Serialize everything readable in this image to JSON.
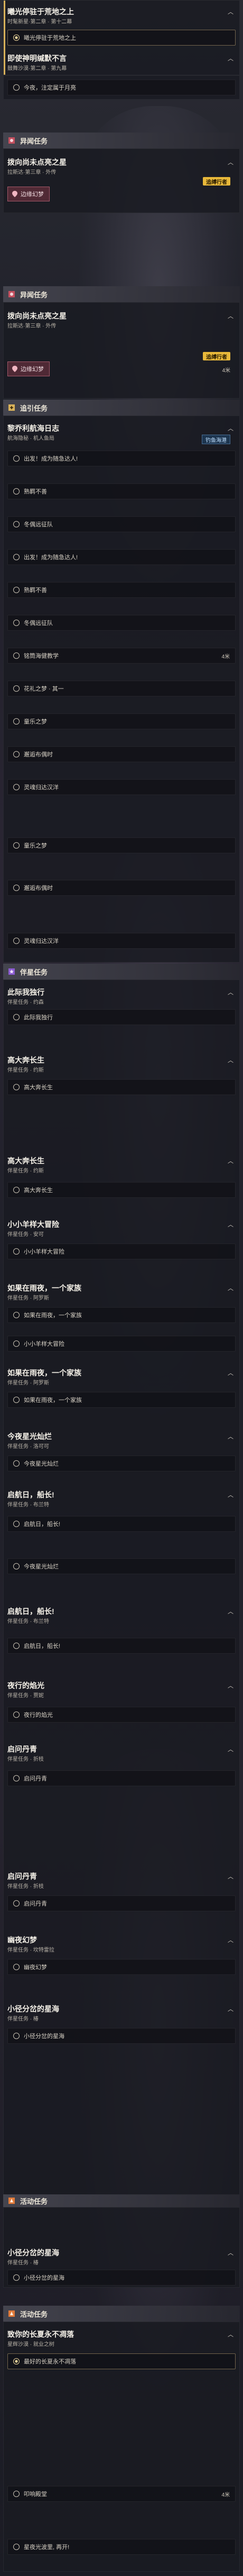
{
  "top": {
    "title1": "曦光停驻于荒地之上",
    "sub1": "时髦新星·第二章 · 第十二幕",
    "step1": "曦光停驻于荒地之上",
    "title2": "即使神明缄默不言",
    "sub2": "鼓舞沙漠·第二章 · 第九幕",
    "step2": "今夜，注定属于月亮"
  },
  "section_weiyi": {
    "label": "异闻任务"
  },
  "weiyi1": {
    "title": "拨向尚未点亮之星",
    "sub": "拉斯达·第三章 · 外传",
    "chip": "边缘幻梦",
    "badge": "追缚行者"
  },
  "section_weiyi2": {
    "label": "异闻任务"
  },
  "weiyi2": {
    "title": "拨向尚未点亮之星",
    "sub": "拉斯达·第三章 · 外传",
    "chip": "边缘幻梦",
    "badge": "追缚行者",
    "dist": "4米"
  },
  "section_zhui": {
    "label": "追引任务"
  },
  "zhui": {
    "title": "黎乔利航海日志",
    "sub": "航海隐秘 · 机人鱼局",
    "tag": "钓鱼海港",
    "steps": [
      "出发！成为随急达人!",
      "熟羁不善",
      "冬偶远征队",
      "出发！成为随急达人!",
      "熟羁不善",
      "冬偶远征队",
      "铭筒海健教学",
      "花礼之梦 · 其一",
      "童乐之梦",
      "邂逅布偶时",
      "灵魂归达汉洋",
      "童乐之梦",
      "邂逅布偶时",
      "灵魂归达汉洋"
    ],
    "dist": "4米"
  },
  "section_xie": {
    "label": "伴星任务"
  },
  "xie": [
    {
      "title": "此际我独行",
      "sub": "伴星任务 · 约森",
      "step": "此际我独行"
    },
    {
      "title": "高大奔长生",
      "sub": "伴星任务 · 约斯",
      "step": "高大奔长生"
    },
    {
      "title": "高大奔长生",
      "sub": "伴星任务 · 约斯",
      "step": "高大奔长生"
    },
    {
      "title": "小小羊样大冒险",
      "sub": "伴星任务 · 安可",
      "step": "小小羊样大冒险"
    },
    {
      "title": "如果在雨夜，一个家族",
      "sub": "伴星任务 · 阿罗斯",
      "step": "如果在雨夜，一个家族",
      "step2": "小小羊样大冒险"
    },
    {
      "title": "如果在雨夜，一个家族",
      "sub": "伴星任务 · 阿罗斯",
      "step": "如果在雨夜，一个家族"
    },
    {
      "title": "今夜星光灿烂",
      "sub": "伴星任务 · 洛可可",
      "step": "今夜星光灿烂"
    },
    {
      "title": "启航日，船长!",
      "sub": "伴星任务 · 布兰特",
      "step": "启航日，船长!",
      "step2": "今夜星光灿烂"
    },
    {
      "title": "启航日，船长!",
      "sub": "伴星任务 · 布兰特",
      "step": "启航日，船长!"
    },
    {
      "title": "夜行的焰光",
      "sub": "伴星任务 · 贾妮",
      "step": "夜行的焰光"
    },
    {
      "title": "启问丹青",
      "sub": "伴星任务 · 折枝",
      "step": "启问丹青"
    },
    {
      "title": "启问丹青",
      "sub": "伴星任务 · 折枝",
      "step": "启问丹青"
    },
    {
      "title": "幽夜幻梦",
      "sub": "伴星任务 · 坎特雷拉",
      "step": "幽夜幻梦"
    },
    {
      "title": "小径分岔的星海",
      "sub": "伴星任务 · 椿",
      "step": "小径分岔的星海"
    }
  ],
  "section_huo1": {
    "label": "活动任务"
  },
  "huo_pre": {
    "title": "小径分岔的星海",
    "sub": "伴星任务 · 椿",
    "step": "小径分岔的星海"
  },
  "section_huo2": {
    "label": "活动任务"
  },
  "huo": {
    "title": "致你的长夏永不凋落",
    "sub": "星辉沙漠 · 就业之树",
    "step1": "最好的长夏永不凋落",
    "step2": "叩响殿堂",
    "step2_dist": "4米",
    "step3": "星夜光波里, 再开!"
  },
  "colors": {
    "accent_gold": "#d8b15a",
    "track_badge": "#e8b83a",
    "weiyi_red": "#c4505f",
    "xie_purple": "#8b5bd1",
    "huo_orange": "#e07a3a"
  }
}
